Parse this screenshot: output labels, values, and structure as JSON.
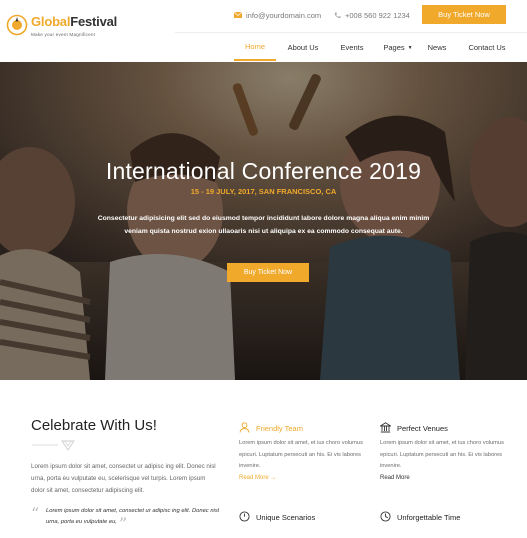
{
  "colors": {
    "accent": "#f0a92b",
    "text_dark": "#222222",
    "text_muted": "#6b6b6b"
  },
  "logo": {
    "brand_part1": "Global",
    "brand_part2": "Festival",
    "tagline": "Make your event Magnificent",
    "icon": "festival-logo-icon"
  },
  "topbar": {
    "email": "info@yourdomain.com",
    "email_icon": "envelope-icon",
    "phone": "+008 560 922 1234",
    "phone_icon": "phone-icon",
    "cta_label": "Buy Ticket Now"
  },
  "nav": {
    "items": [
      {
        "label": "Home",
        "active": true
      },
      {
        "label": "About Us"
      },
      {
        "label": "Events"
      },
      {
        "label": "Pages",
        "has_dropdown": true
      },
      {
        "label": "News"
      },
      {
        "label": "Contact Us"
      }
    ]
  },
  "hero": {
    "title": "International Conference 2019",
    "subtitle": "15 - 19 JULY, 2017, SAN FRANCISCO, CA",
    "description": "Consectetur adipisicing elit sed do eiusmod tempor incididunt labore dolore magna aliqua enim minim veniam quista nostrud exion ullaoaris nisi ut aliquipa ex ea commodo consequat aute.",
    "cta_label": "Buy Ticket Now"
  },
  "about": {
    "title": "Celebrate With Us!",
    "paragraph": "Lorem ipsum dolor sit amet, consectet ur adipisc ing elit. Donec nisl urna, porta eu vulputate eu, scelerisque vel turpis. Lorem ipsum dolor sit amet, consectetur adipiscing elit.",
    "quote": "Lorem ipsum dolor sit amet, consectet ur adipisc ing elit. Donec nisl urna, porta eu vulputate eu,"
  },
  "features": [
    {
      "title": "Friendly Team",
      "icon": "team-icon",
      "description": "Lorem ipsum dolor sit amet, et ius choro volumus epicuri. Luptatum persecuti an his. Ei vis labores invenire.",
      "more": "Read More",
      "more_arrow": "→"
    },
    {
      "title": "Perfect Venues",
      "icon": "venue-icon",
      "description": "Lorem ipsum dolor sit amet, et ius choro volumus epicuri. Luptatum persecuti an his. Ei vis labores invenire.",
      "more": "Read More"
    },
    {
      "title": "Unique Scenarios",
      "icon": "clock-scenario-icon"
    },
    {
      "title": "Unforgettable Time",
      "icon": "time-icon"
    }
  ]
}
